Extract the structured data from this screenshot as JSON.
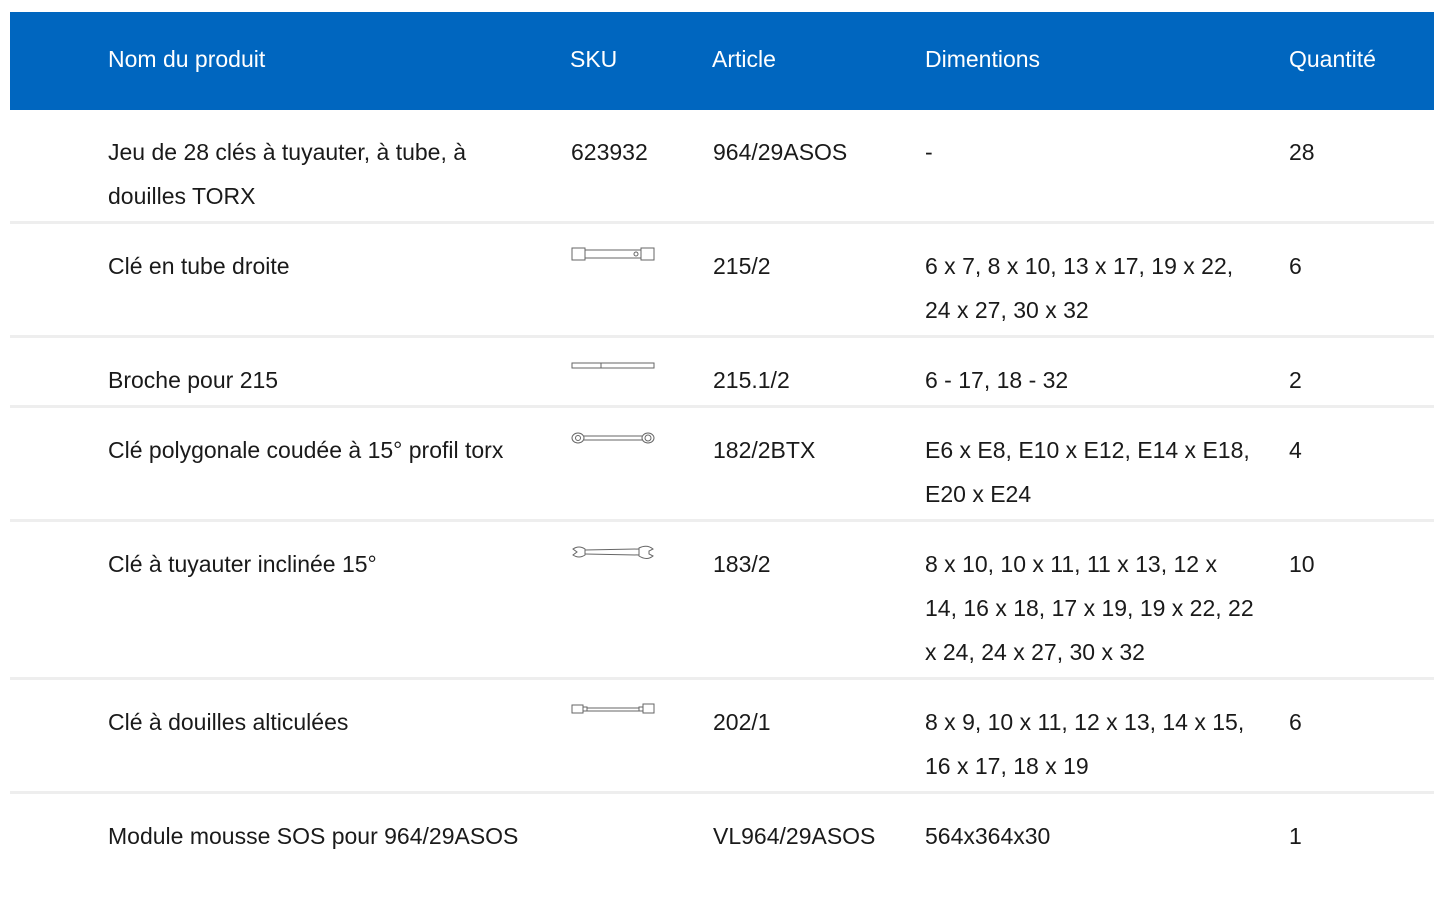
{
  "columns": {
    "name": "Nom du produit",
    "sku": "SKU",
    "article": "Article",
    "dimensions": "Dimentions",
    "quantity": "Quantité"
  },
  "rows": [
    {
      "name": "Jeu de 28 clés à tuyauter, à tube, à douilles TORX",
      "sku": "623932",
      "image": null,
      "article": "964/29ASOS",
      "dimensions": "-",
      "quantity": "28"
    },
    {
      "name": "Clé en tube droite",
      "sku": "",
      "image": "tube-wrench-icon",
      "article": "215/2",
      "dimensions": "6 x 7, 8 x 10, 13 x 17, 19 x 22, 24 x 27, 30 x 32",
      "quantity": "6"
    },
    {
      "name": "Broche pour 215",
      "sku": "",
      "image": "tommy-bar-icon",
      "article": "215.1/2",
      "dimensions": "6 - 17, 18 - 32",
      "quantity": "2"
    },
    {
      "name": "Clé polygonale coudée à 15° profil torx",
      "sku": "",
      "image": "ring-spanner-icon",
      "article": "182/2BTX",
      "dimensions": "E6 x E8, E10 x E12, E14 x E18, E20 x E24",
      "quantity": "4"
    },
    {
      "name": "Clé à tuyauter inclinée 15°",
      "sku": "",
      "image": "flare-nut-wrench-icon",
      "article": "183/2",
      "dimensions": "8 x 10, 10 x 11, 11 x 13, 12 x 14, 16 x 18, 17 x 19, 19 x 22, 22 x 24, 24 x 27, 30 x 32",
      "quantity": "10"
    },
    {
      "name": "Clé à douilles alticulées",
      "sku": "",
      "image": "articulated-socket-wrench-icon",
      "article": "202/1",
      "dimensions": "8 x 9, 10 x 11, 12 x 13, 14 x 15, 16 x 17, 18 x 19",
      "quantity": "6"
    },
    {
      "name": "Module mousse SOS pour 964/29ASOS",
      "sku": "",
      "image": null,
      "article": "VL964/29ASOS",
      "dimensions": "564x364x30",
      "quantity": "1"
    }
  ],
  "colors": {
    "header_bg": "#0066bf",
    "header_text": "#ffffff",
    "row_divider": "#eeeeee",
    "text": "#1a1a1a"
  }
}
